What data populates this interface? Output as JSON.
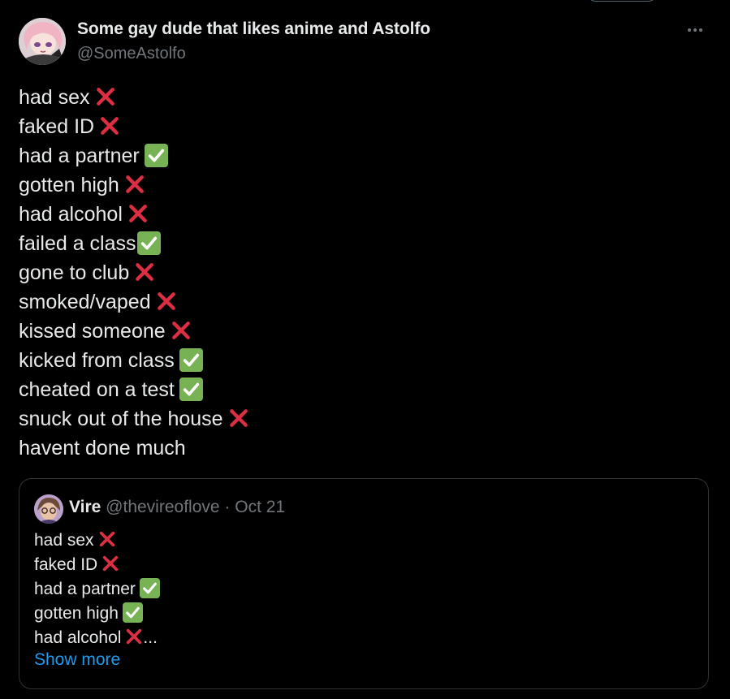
{
  "author": {
    "display_name": "Some gay dude that likes anime and Astolfo",
    "handle": "@SomeAstolfo",
    "avatar_icon": "anime-avatar"
  },
  "more_icon": "ellipsis-icon",
  "tweet_lines": [
    {
      "text": "had sex",
      "mark": "x"
    },
    {
      "text": "faked ID",
      "mark": "x"
    },
    {
      "text": "had a partner",
      "mark": "check"
    },
    {
      "text": "gotten high",
      "mark": "x"
    },
    {
      "text": "had alcohol",
      "mark": "x"
    },
    {
      "text": "failed a class",
      "mark": "check"
    },
    {
      "text": "gone to club",
      "mark": "x"
    },
    {
      "text": "smoked/vaped",
      "mark": "x"
    },
    {
      "text": "kissed someone",
      "mark": "x"
    },
    {
      "text": "kicked from class",
      "mark": "check"
    },
    {
      "text": "cheated on a test",
      "mark": "check"
    },
    {
      "text": "snuck out of the house",
      "mark": "x"
    },
    {
      "text": "havent done much",
      "mark": ""
    }
  ],
  "quoted": {
    "name": "Vire",
    "handle": "@thevireoflove",
    "separator": "·",
    "date": "Oct 21",
    "lines": [
      {
        "text": "had sex",
        "mark": "x"
      },
      {
        "text": "faked ID",
        "mark": "x"
      },
      {
        "text": "had a partner",
        "mark": "check"
      },
      {
        "text": "gotten high",
        "mark": "check"
      },
      {
        "text": "had alcohol",
        "mark": "x",
        "suffix": "..."
      }
    ],
    "show_more": "Show more"
  },
  "colors": {
    "background": "#000000",
    "text": "#e7e9ea",
    "secondary": "#71767b",
    "link": "#1d9bf0",
    "cross": "#dd2e44",
    "check": "#77b255"
  }
}
